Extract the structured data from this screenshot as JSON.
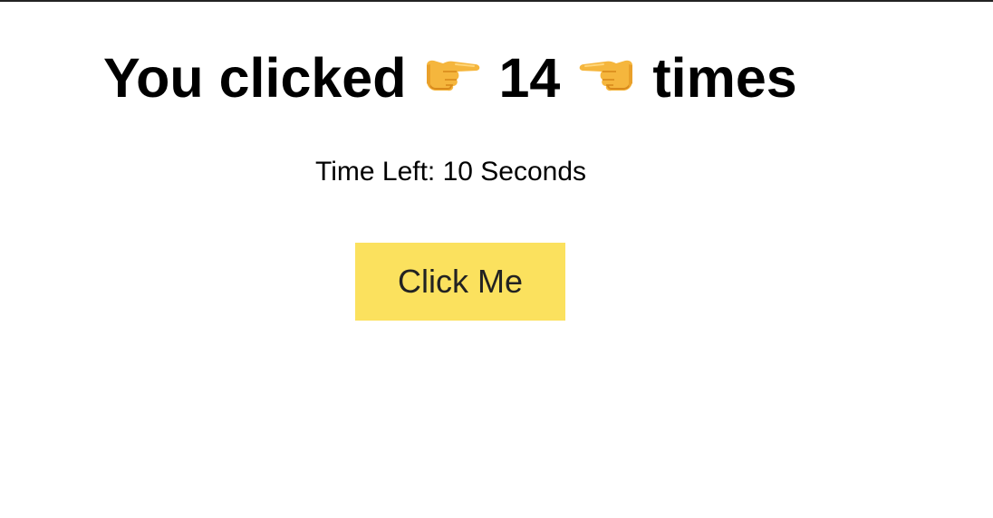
{
  "headline": {
    "prefix": "You clicked",
    "count": "14",
    "suffix": "times",
    "left_emoji": "👉",
    "right_emoji": "👈"
  },
  "timer": {
    "text": "Time Left: 10 Seconds"
  },
  "button": {
    "label": "Click Me",
    "color": "#fbe15e"
  },
  "icons": {
    "left": "pointing-right-hand-icon",
    "right": "pointing-left-hand-icon"
  }
}
